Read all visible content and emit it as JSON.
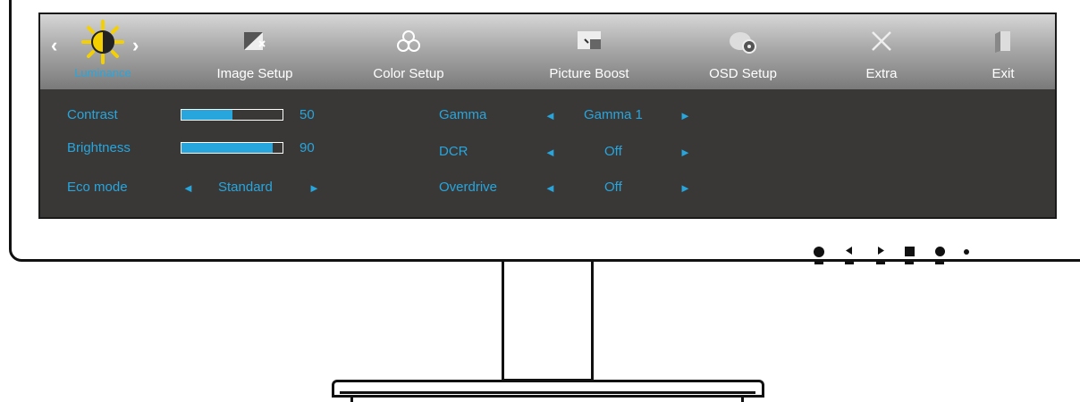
{
  "menu": {
    "tabs": [
      {
        "label": "Luminance",
        "icon": "sun-contrast-icon",
        "active": true
      },
      {
        "label": "Image Setup",
        "icon": "image-setup-icon"
      },
      {
        "label": "Color Setup",
        "icon": "color-setup-icon"
      },
      {
        "label": "Picture Boost",
        "icon": "picture-boost-icon"
      },
      {
        "label": "OSD Setup",
        "icon": "osd-setup-icon"
      },
      {
        "label": "Extra",
        "icon": "extra-tools-icon"
      },
      {
        "label": "Exit",
        "icon": "exit-icon"
      }
    ]
  },
  "settings": {
    "contrast": {
      "label": "Contrast",
      "value": "50",
      "fraction": 0.5
    },
    "brightness": {
      "label": "Brightness",
      "value": "90",
      "fraction": 0.9
    },
    "eco_mode": {
      "label": "Eco mode",
      "value": "Standard"
    },
    "gamma": {
      "label": "Gamma",
      "value": "Gamma 1"
    },
    "dcr": {
      "label": "DCR",
      "value": "Off"
    },
    "overdrive": {
      "label": "Overdrive",
      "value": "Off"
    }
  },
  "colors": {
    "accent": "#27a6de",
    "panel": "#3a3836"
  },
  "front_buttons": [
    "power-icon",
    "left-icon",
    "right-icon",
    "menu-icon",
    "source-icon",
    "led-icon"
  ]
}
